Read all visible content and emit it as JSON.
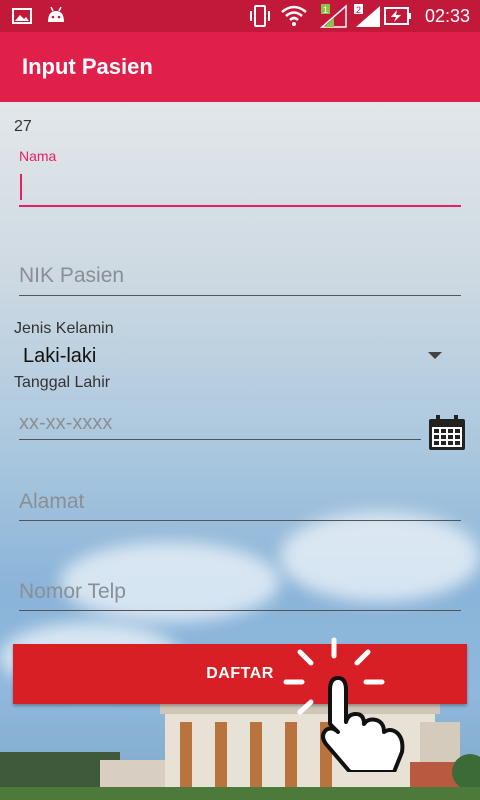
{
  "status_bar": {
    "time": "02:33",
    "icons": [
      "gallery-icon",
      "android-icon",
      "vibrate-icon",
      "wifi-icon",
      "signal-1-icon",
      "signal-2-icon",
      "battery-charging-icon"
    ]
  },
  "app_bar": {
    "title": "Input Pasien"
  },
  "form": {
    "counter": "27",
    "nama": {
      "label": "Nama",
      "value": ""
    },
    "nik": {
      "placeholder": "NIK Pasien"
    },
    "gender": {
      "label": "Jenis Kelamin",
      "selected": "Laki-laki"
    },
    "birth": {
      "label": "Tanggal Lahir",
      "placeholder": "xx-xx-xxxx"
    },
    "alamat": {
      "placeholder": "Alamat"
    },
    "telp": {
      "placeholder": "Nomor Telp"
    },
    "submit_label": "DAFTAR"
  },
  "colors": {
    "status": "#c2183a",
    "app_bar": "#e0204a",
    "accent": "#e91e63",
    "button": "#d91f26"
  }
}
